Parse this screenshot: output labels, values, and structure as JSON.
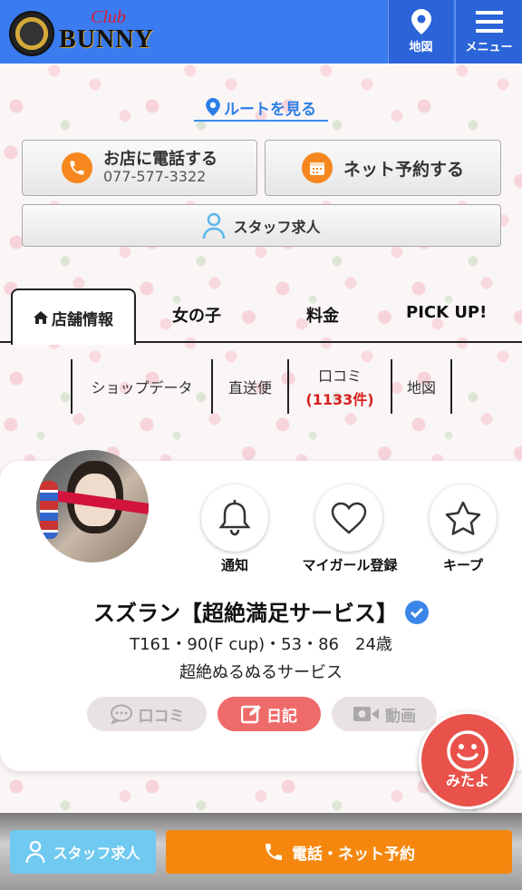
{
  "header": {
    "logo_text": "BUNNY",
    "logo_script": "Club",
    "map_label": "地図",
    "menu_label": "メニュー"
  },
  "route": {
    "label": "ルートを見る"
  },
  "actions": {
    "call_title": "お店に電話する",
    "call_number": "077-577-3322",
    "net_reserve": "ネット予約する",
    "staff_recruit": "スタッフ求人"
  },
  "tabs": [
    {
      "label": "店舗情報",
      "active": true
    },
    {
      "label": "女の子"
    },
    {
      "label": "料金"
    },
    {
      "label": "PICK UP!"
    }
  ],
  "subnav": {
    "shop_data": "ショップデータ",
    "direct": "直送便",
    "review": "口コミ",
    "review_count": "(1133件)",
    "map": "地図"
  },
  "profile": {
    "buttons": {
      "notify": "通知",
      "my_girl": "マイガール登録",
      "keep": "キープ"
    },
    "name": "スズラン【超絶満足サービス】",
    "stats": "T161・90(F cup)・53・86　24歳",
    "catchphrase": "超絶ぬるぬるサービス",
    "pills": {
      "review": "口コミ",
      "diary": "日記",
      "video": "動画"
    }
  },
  "floating": {
    "mitayo": "みたよ"
  },
  "bottom": {
    "staff_recruit": "スタッフ求人",
    "call_reserve": "電話・ネット予約"
  },
  "colors": {
    "header_blue": "#3a7bf0",
    "accent_orange": "#f5871e",
    "diary_red": "#ef6a6a",
    "review_count_red": "#d6201f",
    "staff_blue": "#6fc9f0"
  }
}
